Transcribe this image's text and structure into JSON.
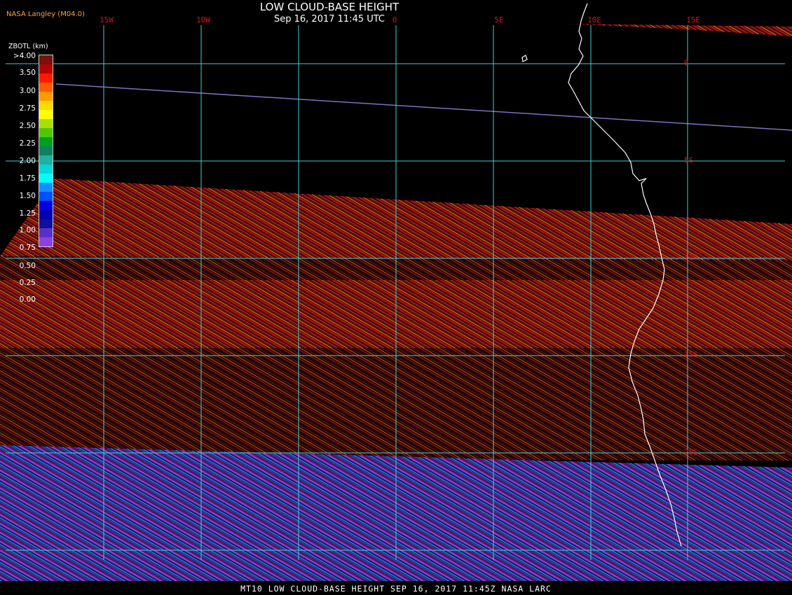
{
  "header": {
    "title": "LOW CLOUD-BASE HEIGHT",
    "subtitle": "Sep 16, 2017 11:45 UTC",
    "org": "NASA Langley (M04.0)"
  },
  "footer": {
    "text": "MT10  LOW CLOUD-BASE HEIGHT  SEP 16, 2017 11:45Z  NASA LARC"
  },
  "map": {
    "lon_labels": [
      "15W",
      "10W",
      "0",
      "5E",
      "10E",
      "15E"
    ],
    "lat_labels": [
      "0",
      "5S",
      "10S",
      "15S",
      "20S"
    ],
    "grid_color": "#40d0d0",
    "coastline_color": "#ffffff",
    "label_color": "#d01818"
  },
  "legend": {
    "title": "ZBOTL (km)",
    "labels": [
      ">4.00",
      "3.50",
      "3.00",
      "2.75",
      "2.50",
      "2.25",
      "2.00",
      "1.75",
      "1.50",
      "1.25",
      "1.00",
      "0.75",
      "0.50",
      "0.25",
      "0.00"
    ],
    "colors": [
      "#7a1010",
      "#b80000",
      "#ff1a00",
      "#ff5a00",
      "#ff9a00",
      "#ffd800",
      "#ffff00",
      "#a8e000",
      "#50c800",
      "#00a020",
      "#108060",
      "#20b0a0",
      "#00d8d8",
      "#00ffff",
      "#1090ff",
      "#0050ff",
      "#0000e0",
      "#0000b0",
      "#1010a0",
      "#5a30c8",
      "#9040e0"
    ]
  }
}
